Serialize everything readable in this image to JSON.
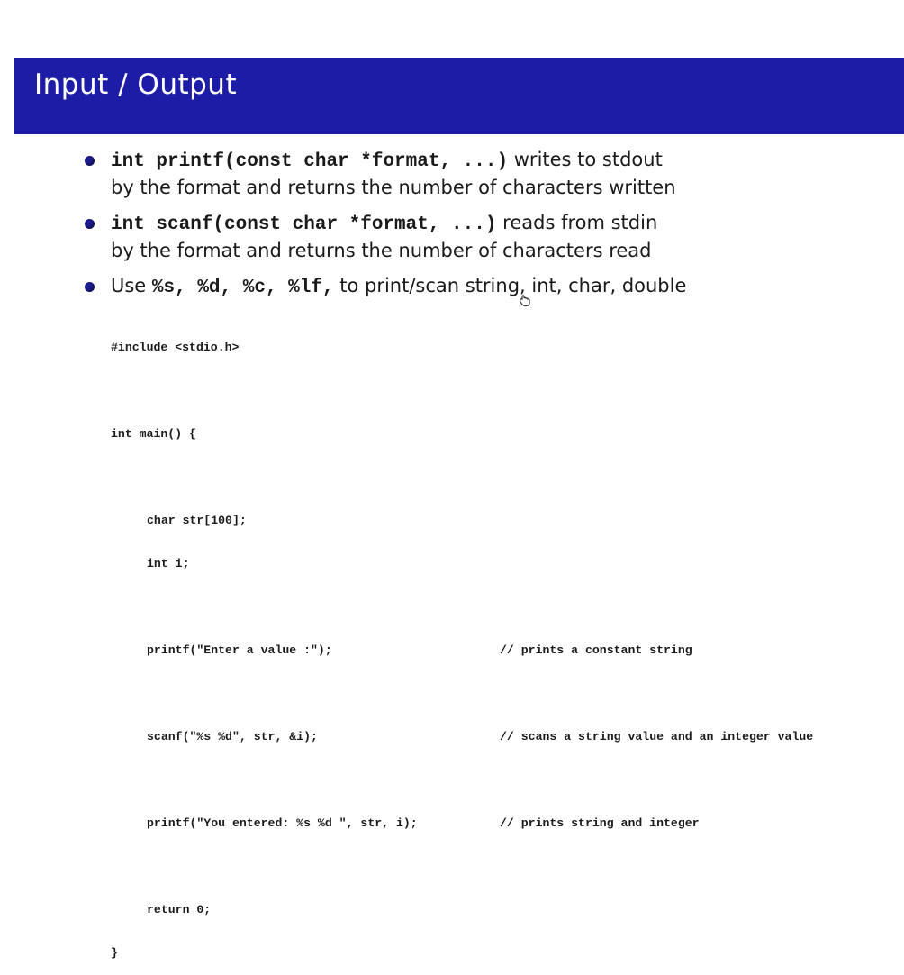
{
  "slide": {
    "title": "Input / Output"
  },
  "bullets": [
    {
      "code": "int printf(const char *format, ...)",
      "text": " writes to stdout",
      "line2": "by the format and returns the number of characters written"
    },
    {
      "code": "int scanf(const char *format, ...)",
      "text": " reads from stdin",
      "line2": "by the format and returns the number of characters read"
    },
    {
      "pre": "Use ",
      "code": "%s, %d, %c, %lf,",
      "text": " to print/scan string, int, char, double"
    }
  ],
  "code": {
    "include": "#include <stdio.h>",
    "main": "int main() {",
    "decl_str": "char str[100];",
    "decl_i": "int i;",
    "printf1": "printf(\"Enter a value :\");",
    "comment1": "// prints a constant string",
    "scanf": "scanf(\"%s %d\", str, &i);",
    "comment2": "// scans a string value and an integer value",
    "printf2": "printf(\"You entered: %s %d \", str, i);",
    "comment3": "// prints string and integer",
    "ret": "return 0;",
    "close": "}"
  },
  "icons": {
    "cursor": "hand-cursor-icon"
  }
}
